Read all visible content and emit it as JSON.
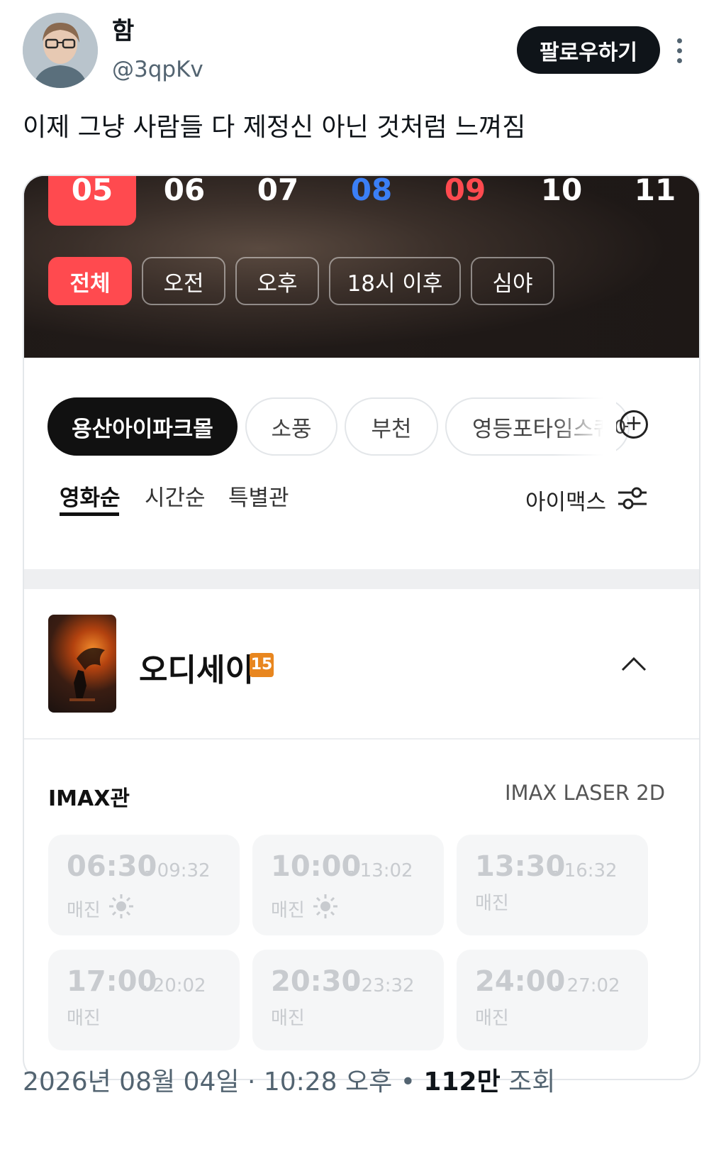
{
  "tweet": {
    "display_name": "함",
    "handle": "@3qpKv",
    "follow_label": "팔로우하기",
    "text": "이제 그냥 사람들 다 제정신 아닌 것처럼 느껴짐"
  },
  "booking": {
    "dates": [
      {
        "label": "05",
        "state": "selected"
      },
      {
        "label": "06",
        "state": "weekday"
      },
      {
        "label": "07",
        "state": "weekday"
      },
      {
        "label": "08",
        "state": "saturday"
      },
      {
        "label": "09",
        "state": "sunday"
      },
      {
        "label": "10",
        "state": "weekday"
      },
      {
        "label": "11",
        "state": "weekday"
      }
    ],
    "time_filters": [
      "전체",
      "오전",
      "오후",
      "18시 이후",
      "심야"
    ],
    "theaters": [
      "용산아이파크몰",
      "소풍",
      "부천",
      "영등포타임스퀘어"
    ],
    "sort_tabs": [
      "영화순",
      "시간순",
      "특별관"
    ],
    "imax_filter_label": "아이맥스",
    "movie": {
      "title": "오디세이",
      "rating": "15"
    },
    "screen": {
      "name": "IMAX관",
      "format": "IMAX LASER 2D"
    },
    "showtimes": [
      {
        "start": "06:30",
        "end": "- 09:32",
        "status": "매진",
        "morning": true
      },
      {
        "start": "10:00",
        "end": "- 13:02",
        "status": "매진",
        "morning": true
      },
      {
        "start": "13:30",
        "end": "- 16:32",
        "status": "매진",
        "morning": false
      },
      {
        "start": "17:00",
        "end": "- 20:02",
        "status": "매진",
        "morning": false
      },
      {
        "start": "20:30",
        "end": "- 23:32",
        "status": "매진",
        "morning": false
      },
      {
        "start": "24:00",
        "end": "- 27:02",
        "status": "매진",
        "morning": false
      }
    ],
    "colors": {
      "accent": "#ff4a4f",
      "saturday": "#3b7ff6",
      "rating": "#e8861f"
    }
  },
  "meta": {
    "date": "2026년 08월 04일",
    "sep1": "·",
    "time": "10:28 오후",
    "sep2": "•",
    "views": "112만",
    "views_label": "조회"
  }
}
